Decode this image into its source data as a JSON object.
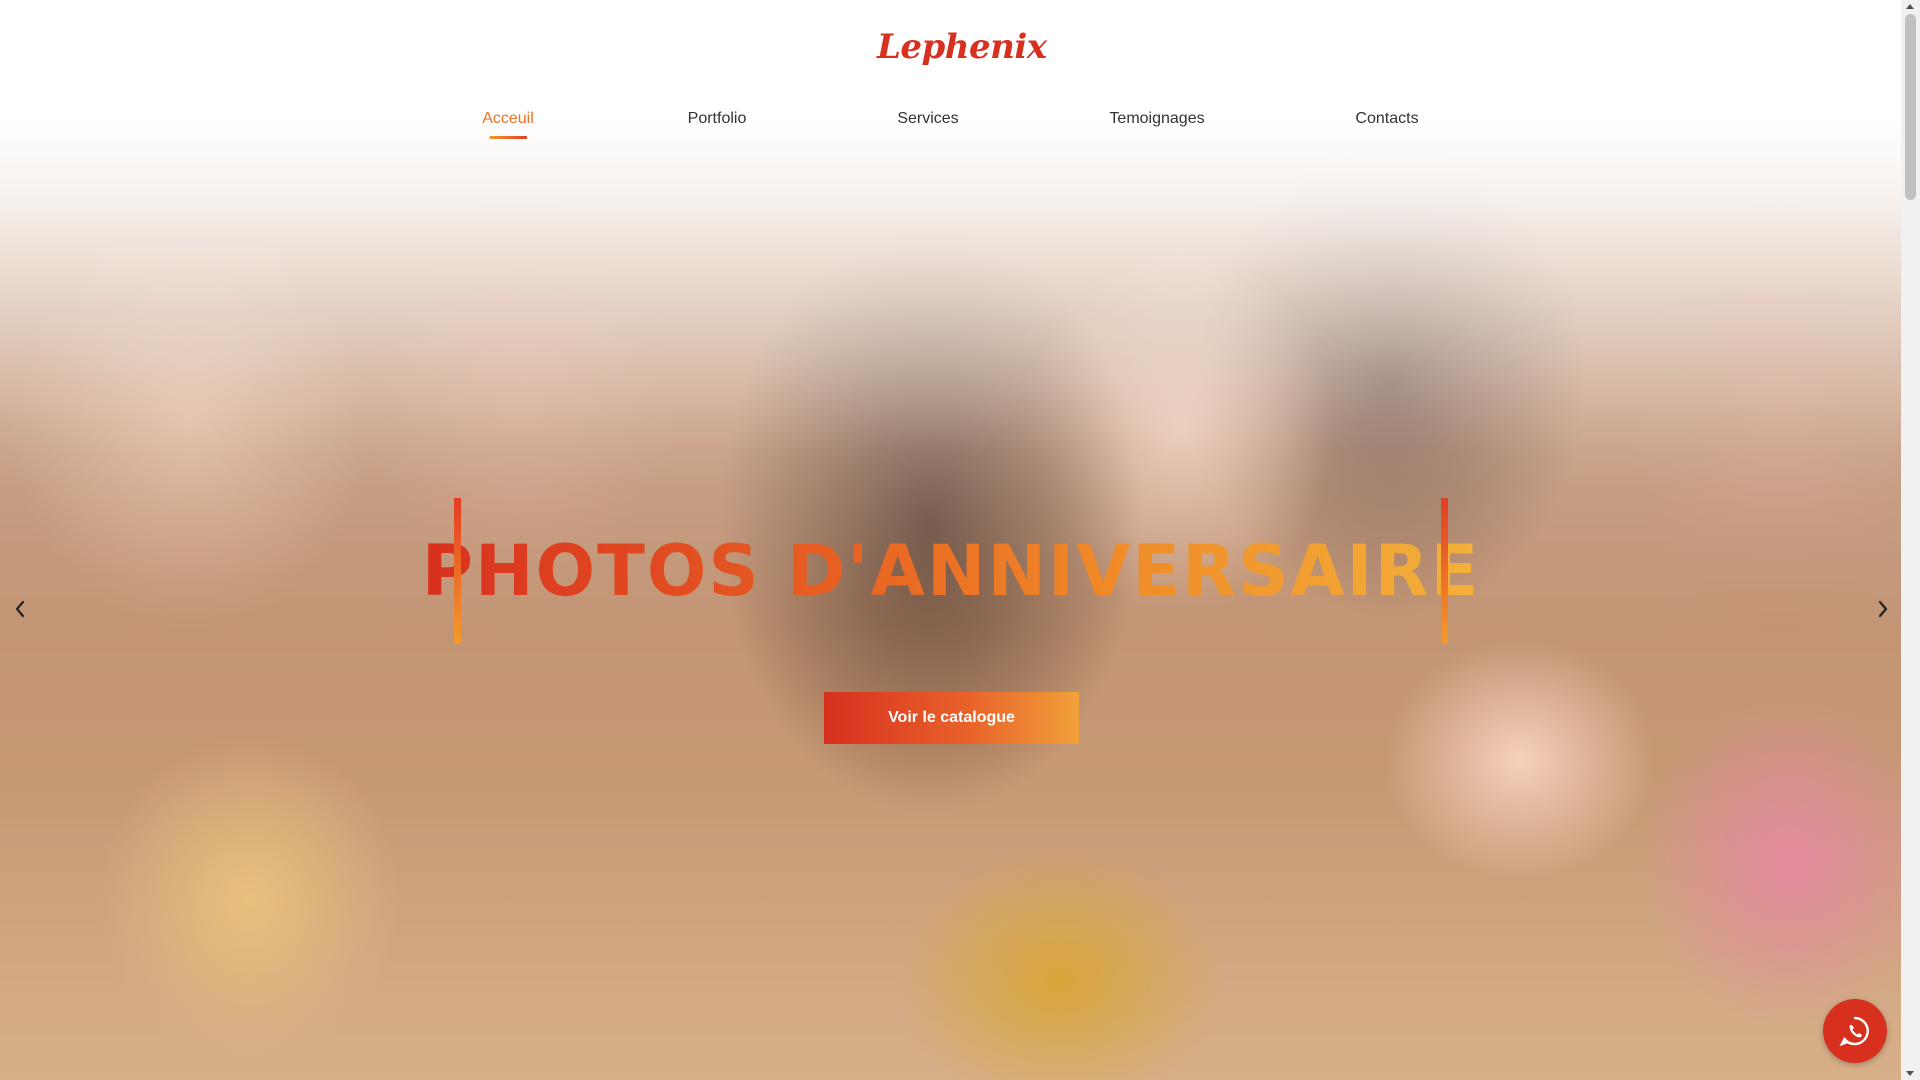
{
  "brand": {
    "name": "Lephenix",
    "logo_icon": "phoenix-logo-icon",
    "color": "#d8301f"
  },
  "nav": {
    "items": [
      {
        "label": "Acceuil",
        "active": true
      },
      {
        "label": "Portfolio",
        "active": false
      },
      {
        "label": "Services",
        "active": false
      },
      {
        "label": "Temoignages",
        "active": false
      },
      {
        "label": "Contacts",
        "active": false
      }
    ],
    "active_color": "#e8732b"
  },
  "hero": {
    "headline": "PHOTOS D'ANNIVERSAIRE",
    "cta_label": "Voir le catalogue",
    "prev_icon": "chevron-left-icon",
    "next_icon": "chevron-right-icon",
    "gradient_start": "#d8301f",
    "gradient_end": "#f3b13a"
  },
  "chat": {
    "icon": "whatsapp-icon",
    "color": "#d7301f"
  }
}
